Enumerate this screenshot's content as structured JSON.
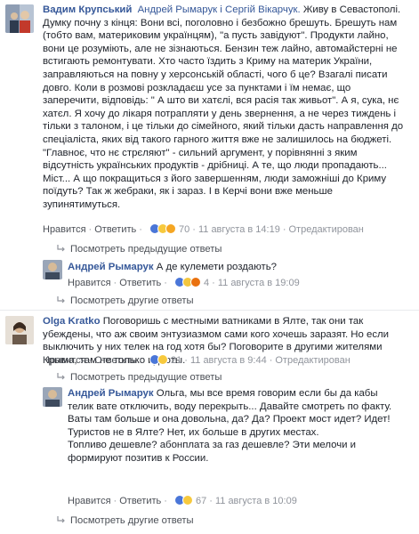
{
  "comments": [
    {
      "author": "Вадим Крупський",
      "tags": "Андрей Рымарук і Сергій Вікарчук.",
      "lines": [
        " Живу в Севастополі.",
        "Думку почну з кінця: Вони всі, поголовно і безбожно брешуть. Брешуть нам",
        "(тобто вам, материковим українцям), \"а пусть завідуют\". Продукти лайно,",
        "вони це розуміють, але не зізнаються. Бензин теж лайно, автомайстерні не",
        "встигають ремонтувати. Хто часто їздить з Криму на материк України,",
        "заправляються на повну у херсонській області, чого б це? Взагалі писати",
        "довго. Коли в розмові розкладаєш усе за пунктами і їм немає, що",
        "заперечити, відповідь: \" А што ви хатєлі, вся расія так живьот\". А я, сука, нє",
        "хатєл. Я хочу до лікаря потрапляти у день звернення, а не через тиждень і",
        "тільки з талоном, і це тільки до сімейного, який тільки дасть направлення до",
        "спеціаліста, яких від такого гарного життя вже не залишилось на бюджеті.",
        "\"Главноє, что нє стрєляют\" - сильний аргумент, у порівнянні з яким",
        "відсутність українських продуктів - дрібниці. А те, що люди пропадають...",
        "Міст... А що покращиться з його завершенням, люди заможніші до Криму",
        "поїдуть? Так ж жебраки, як і зараз. І в Керчі вони вже меньше",
        "зупинятимуться."
      ],
      "like": "Нравится",
      "reply": "Ответить",
      "reactions_count": "70",
      "time": "11 августа в 14:19",
      "edited": "Отредактирован",
      "more": "Посмотреть предыдущие ответы"
    },
    {
      "author": "Андрей Рымарук",
      "lines": [
        " А де кулемети роздають?"
      ],
      "like": "Нравится",
      "reply": "Ответить",
      "reactions_count": "4",
      "time": "11 августа в 19:09",
      "more": "Посмотреть другие ответы"
    },
    {
      "author": "Olga Kratko",
      "lines": [
        " Поговоришь с местными ватниками в Ялте, так они так",
        "убеждены, что аж своим энтузиазмом сами кого хочешь заразят. Но если",
        "выключить у них телек на год хотя бы? Поговорите в другими жителями",
        "Крыма, там не только идиоты."
      ],
      "like": "Нравится",
      "reply": "Ответить",
      "reactions_count": "21",
      "time": "11 августа в 9:44",
      "edited": "Отредактирован",
      "more": "Посмотреть предыдущие ответы"
    },
    {
      "author": "Андрей Рымарук",
      "lines": [
        " Ольга, мы все время говорим если бы да кабы",
        "телик вате отключить, воду перекрыть... Давайте смотреть по факту.",
        "Ваты там больше и она довольна, да? Да? Проект мост идет? Идет!",
        "Туристов не в Ялте? Нет, их больше в других местах.",
        "Топливо дешевле? абонплата за газ дешевле? Эти мелочи и",
        "формируют позитив к России."
      ],
      "like": "Нравится",
      "reply": "Ответить",
      "reactions_count": "67",
      "time": "11 августа в 10:09",
      "more": "Посмотреть другие ответы"
    }
  ],
  "colors": {
    "author": "#365899",
    "text": "#1d2129",
    "meta": "#90949c"
  }
}
